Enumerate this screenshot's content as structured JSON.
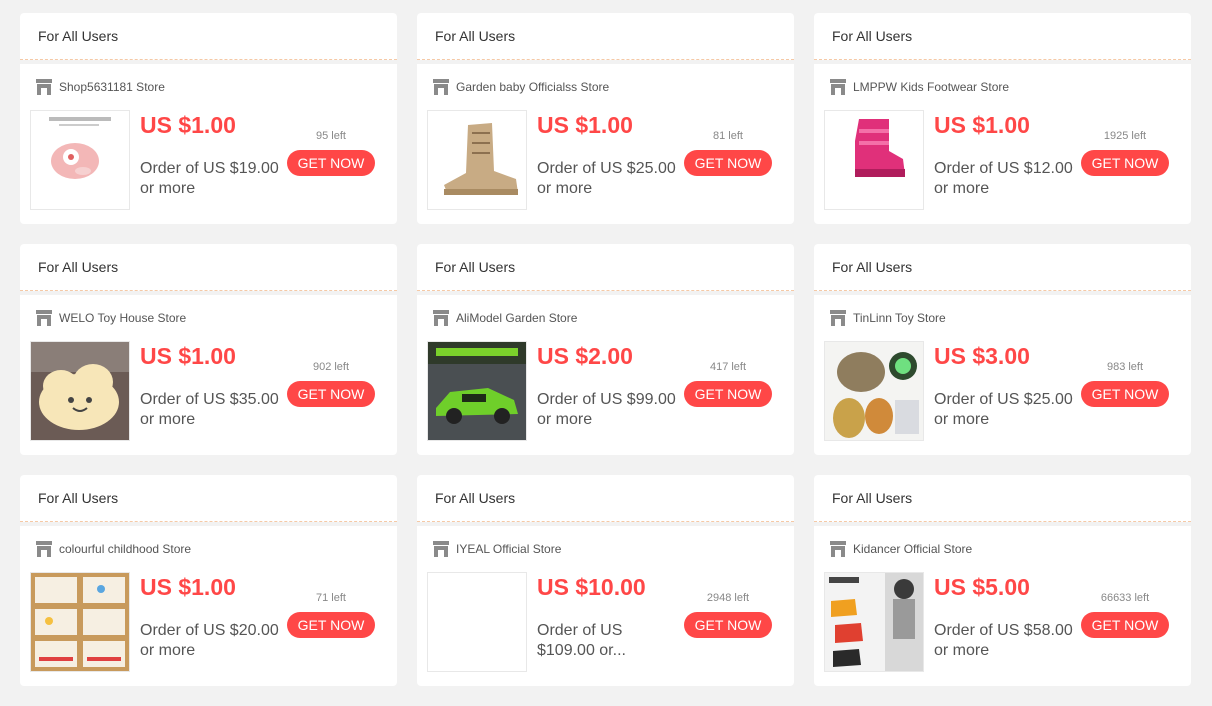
{
  "coupons": [
    {
      "header": "For All Users",
      "store": "Shop5631181 Store",
      "price": "US $1.00",
      "condition": "Order of US $19.00 or more",
      "left": "95 left",
      "button": "GET NOW",
      "thumb": "toy-bag-image"
    },
    {
      "header": "For All Users",
      "store": "Garden baby Officialss Store",
      "price": "US $1.00",
      "condition": "Order of US $25.00 or more",
      "left": "81 left",
      "button": "GET NOW",
      "thumb": "boot-image"
    },
    {
      "header": "For All Users",
      "store": "LMPPW Kids Footwear Store",
      "price": "US $1.00",
      "condition": "Order of US $12.00 or more",
      "left": "1925 left",
      "button": "GET NOW",
      "thumb": "pink-boot-image"
    },
    {
      "header": "For All Users",
      "store": "WELO Toy House Store",
      "price": "US $1.00",
      "condition": "Order of US $35.00 or more",
      "left": "902 left",
      "button": "GET NOW",
      "thumb": "cloud-pillow-image"
    },
    {
      "header": "For All Users",
      "store": "AliModel Garden Store",
      "price": "US $2.00",
      "condition": "Order of US $99.00 or more",
      "left": "417 left",
      "button": "GET NOW",
      "thumb": "toy-car-image"
    },
    {
      "header": "For All Users",
      "store": "TinLinn Toy Store",
      "price": "US $3.00",
      "condition": "Order of US $25.00 or more",
      "left": "983 left",
      "button": "GET NOW",
      "thumb": "dino-egg-image"
    },
    {
      "header": "For All Users",
      "store": "colourful childhood Store",
      "price": "US $1.00",
      "condition": "Order of US $20.00 or more",
      "left": "71 left",
      "button": "GET NOW",
      "thumb": "boxes-image"
    },
    {
      "header": "For All Users",
      "store": "IYEAL Official Store",
      "price": "US $10.00",
      "condition": "Order of US $109.00 or...",
      "left": "2948 left",
      "button": "GET NOW",
      "thumb": "blank-image"
    },
    {
      "header": "For All Users",
      "store": "Kidancer Official Store",
      "price": "US $5.00",
      "condition": "Order of US $58.00 or more",
      "left": "66633 left",
      "button": "GET NOW",
      "thumb": "kids-shoes-image"
    }
  ],
  "colors": {
    "accent": "#ff4747",
    "background": "#f2f2f2",
    "divider": "#f5c9a6"
  }
}
